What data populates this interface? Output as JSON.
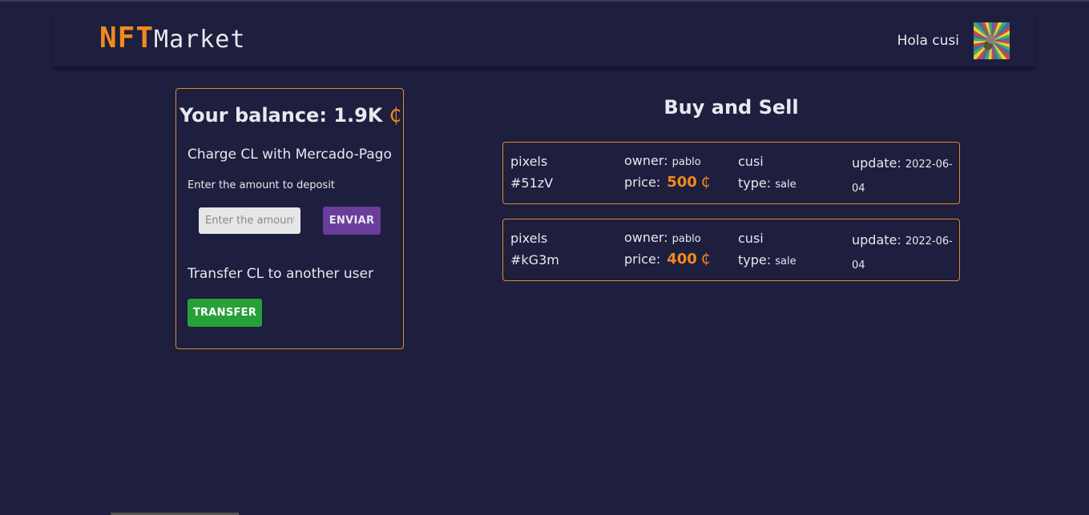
{
  "header": {
    "logo_nft": "NFT",
    "logo_market": "Market",
    "greeting": "Hola cusi"
  },
  "balance": {
    "title": "Your balance: 1.9K",
    "currency_symbol": "₵",
    "charge_title": "Charge CL with Mercado-Pago",
    "deposit_label": "Enter the amount to deposit",
    "amount_placeholder": "Enter the amount",
    "send_label": "ENVIAR",
    "transfer_title": "Transfer CL to another user",
    "transfer_label": "TRANSFER"
  },
  "market": {
    "title": "Buy and Sell",
    "listings": [
      {
        "name": "pixels",
        "id": "#51zV",
        "owner_label": "owner:",
        "owner": "pablo",
        "price_label": "price:",
        "price": "500",
        "user": "cusi",
        "type_label": "type:",
        "type": "sale",
        "update_label": "update:",
        "update": "2022-06-04"
      },
      {
        "name": "pixels",
        "id": "#kG3m",
        "owner_label": "owner:",
        "owner": "pablo",
        "price_label": "price:",
        "price": "400",
        "user": "cusi",
        "type_label": "type:",
        "type": "sale",
        "update_label": "update:",
        "update": "2022-06-04"
      }
    ]
  },
  "colors": {
    "background": "#1e1e3f",
    "accent": "#f28a1c",
    "send_button": "#6a3d9a",
    "transfer_button": "#27a03a"
  }
}
